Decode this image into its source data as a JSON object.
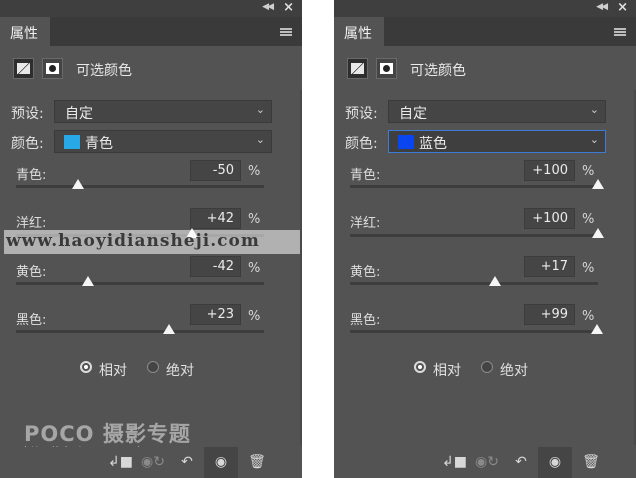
{
  "panels": [
    {
      "tab_label": "属性",
      "title": "可选颜色",
      "preset_label": "预设:",
      "preset_value": "自定",
      "color_label": "颜色:",
      "color_value": "青色",
      "color_swatch": "#29a8e8",
      "color_focused": false,
      "sliders": [
        {
          "label": "青色:",
          "value": "-50",
          "unit": "%",
          "level": 0.25
        },
        {
          "label": "洋红:",
          "value": "+42",
          "unit": "%",
          "level": 0.71
        },
        {
          "label": "黄色:",
          "value": "-42",
          "unit": "%",
          "level": 0.29
        },
        {
          "label": "黑色:",
          "value": "+23",
          "unit": "%",
          "level": 0.615
        }
      ],
      "method": {
        "relative": "相对",
        "absolute": "绝对",
        "selected": "relative"
      }
    },
    {
      "tab_label": "属性",
      "title": "可选颜色",
      "preset_label": "预设:",
      "preset_value": "自定",
      "color_label": "颜色:",
      "color_value": "蓝色",
      "color_swatch": "#0a46f0",
      "color_focused": true,
      "sliders": [
        {
          "label": "青色:",
          "value": "+100",
          "unit": "%",
          "level": 1.0
        },
        {
          "label": "洋红:",
          "value": "+100",
          "unit": "%",
          "level": 1.0
        },
        {
          "label": "黄色:",
          "value": "+17",
          "unit": "%",
          "level": 0.585
        },
        {
          "label": "黑色:",
          "value": "+99",
          "unit": "%",
          "level": 0.995
        }
      ],
      "method": {
        "relative": "相对",
        "absolute": "绝对",
        "selected": "relative"
      }
    }
  ],
  "watermarks": {
    "website": "www.haoyidiansheji.com",
    "logo": "POCO 摄影专题",
    "logo_url": "http://photo.poco.cn/"
  },
  "icons": {
    "clip": "clip-to-layer-icon",
    "view_prev": "view-previous-state-icon",
    "reset": "reset-icon",
    "visibility": "eye-icon",
    "delete": "trash-icon"
  }
}
